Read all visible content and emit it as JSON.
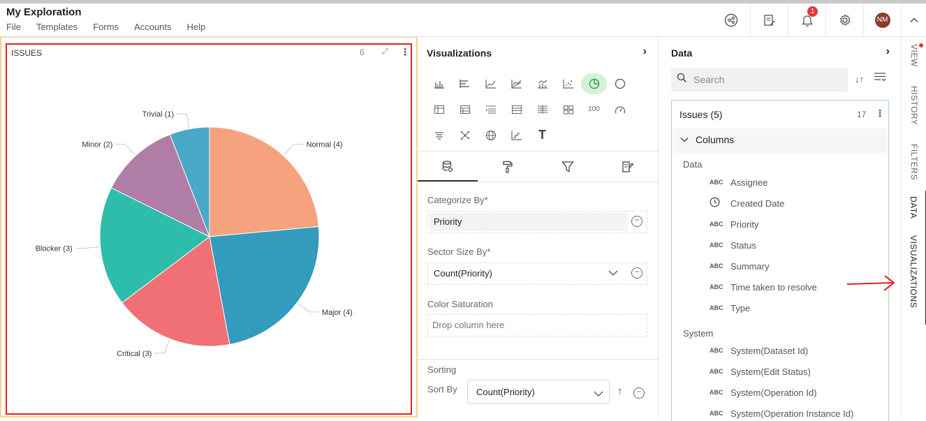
{
  "app": {
    "title": "My Exploration",
    "menu": [
      "File",
      "Templates",
      "Forms",
      "Accounts",
      "Help"
    ],
    "notification_count": "1",
    "avatar_initials": "NM"
  },
  "chart_panel": {
    "title": "ISSUES",
    "count": "6"
  },
  "chart_data": {
    "type": "pie",
    "title": "ISSUES",
    "categories": [
      "Normal",
      "Major",
      "Critical",
      "Blocker",
      "Minor",
      "Trivial"
    ],
    "values": [
      4,
      4,
      3,
      3,
      2,
      1
    ],
    "labels": [
      "Normal (4)",
      "Major (4)",
      "Critical (3)",
      "Blocker (3)",
      "Minor (2)",
      "Trivial (1)"
    ],
    "colors": [
      "#f7a27e",
      "#339bbb",
      "#f07075",
      "#2ebdab",
      "#b07da6",
      "#4aa8c8"
    ],
    "start": "12 o'clock",
    "direction": "clockwise"
  },
  "visualizations": {
    "title": "Visualizations",
    "icon_rows": [
      [
        "bar-chart-icon",
        "horizontal-bar-icon",
        "line-chart-icon",
        "area-chart-icon",
        "combo-chart-icon",
        "scatter-chart-icon",
        "pie-chart-icon",
        "doughnut-chart-icon"
      ],
      [
        "pivot-icon",
        "table-icon",
        "grid-icon",
        "list-icon",
        "sheet-icon",
        "cards-icon",
        "kpi-icon",
        "gauge-icon"
      ],
      [
        "funnel-icon",
        "network-icon",
        "globe-icon",
        "step-chart-icon",
        "text-icon"
      ]
    ],
    "kpi_text": "100",
    "text_glyph": "T",
    "active_icon": "pie-chart-icon",
    "categorize_label": "Categorize By*",
    "categorize_value": "Priority",
    "sector_label": "Sector Size By*",
    "sector_value": "Count(Priority)",
    "saturation_label": "Color Saturation",
    "saturation_placeholder": "Drop column here",
    "sorting_label": "Sorting",
    "sort_by_label": "Sort By",
    "sort_by_value": "Count(Priority)"
  },
  "data": {
    "title": "Data",
    "search_placeholder": "Search",
    "dataset_title": "Issues (5)",
    "dataset_count": "17",
    "columns_label": "Columns",
    "group_data": "Data",
    "data_columns": [
      {
        "type": "ABC",
        "name": "Assignee"
      },
      {
        "type": "clock",
        "name": "Created Date"
      },
      {
        "type": "ABC",
        "name": "Priority"
      },
      {
        "type": "ABC",
        "name": "Status"
      },
      {
        "type": "ABC",
        "name": "Summary"
      },
      {
        "type": "ABC",
        "name": "Time taken to resolve"
      },
      {
        "type": "ABC",
        "name": "Type"
      }
    ],
    "group_system": "System",
    "system_columns": [
      {
        "type": "ABC",
        "name": "System(Dataset Id)"
      },
      {
        "type": "ABC",
        "name": "System(Edit Status)"
      },
      {
        "type": "ABC",
        "name": "System(Operation Id)"
      },
      {
        "type": "ABC",
        "name": "System(Operation Instance Id)"
      }
    ]
  },
  "side_tabs": {
    "view": "VIEW",
    "history": "HISTORY",
    "filters": "FILTERS",
    "data": "DATA",
    "visualizations": "VISUALIZATIONS",
    "active": "DATA"
  }
}
